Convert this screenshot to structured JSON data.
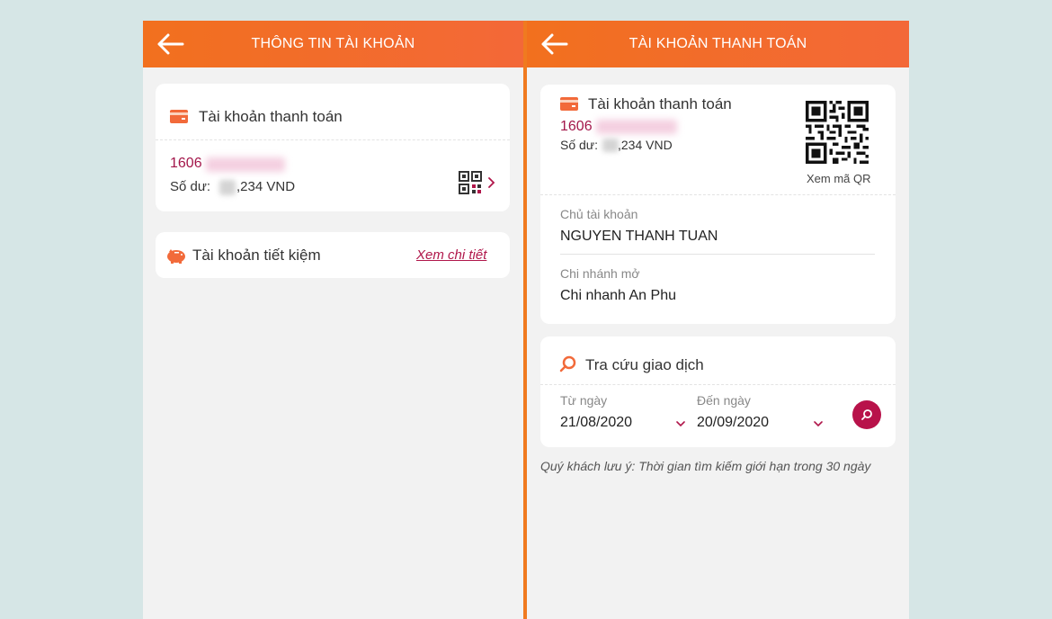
{
  "left_screen": {
    "title": "THÔNG TIN TÀI KHOẢN",
    "payment_card": {
      "header": "Tài khoản thanh toán",
      "account_number_prefix": "1606",
      "balance_label": "Số dư:",
      "balance_suffix": ",234 VND"
    },
    "savings_card": {
      "label": "Tài khoản tiết kiệm",
      "link": "Xem chi tiết"
    }
  },
  "right_screen": {
    "title": "TÀI KHOẢN THANH TOÁN",
    "account_card": {
      "header": "Tài khoản thanh toán",
      "account_number_prefix": "1606",
      "balance_label": "Số dư:",
      "balance_suffix": ",234 VND",
      "qr_caption": "Xem mã QR",
      "owner_label": "Chủ tài khoản",
      "owner_value": "NGUYEN THANH TUAN",
      "branch_label": "Chi nhánh mở",
      "branch_value": "Chi nhanh An Phu"
    },
    "search_card": {
      "header": "Tra cứu giao dịch",
      "from_label": "Từ ngày",
      "from_value": "21/08/2020",
      "to_label": "Đến ngày",
      "to_value": "20/09/2020"
    },
    "note": "Quý khách lưu ý: Thời gian tìm kiếm giới hạn trong 30 ngày"
  },
  "colors": {
    "header_orange": "#f2701e",
    "accent_crimson": "#b0164a",
    "icon_orange": "#f26a3a",
    "background": "#f2f2f2"
  }
}
